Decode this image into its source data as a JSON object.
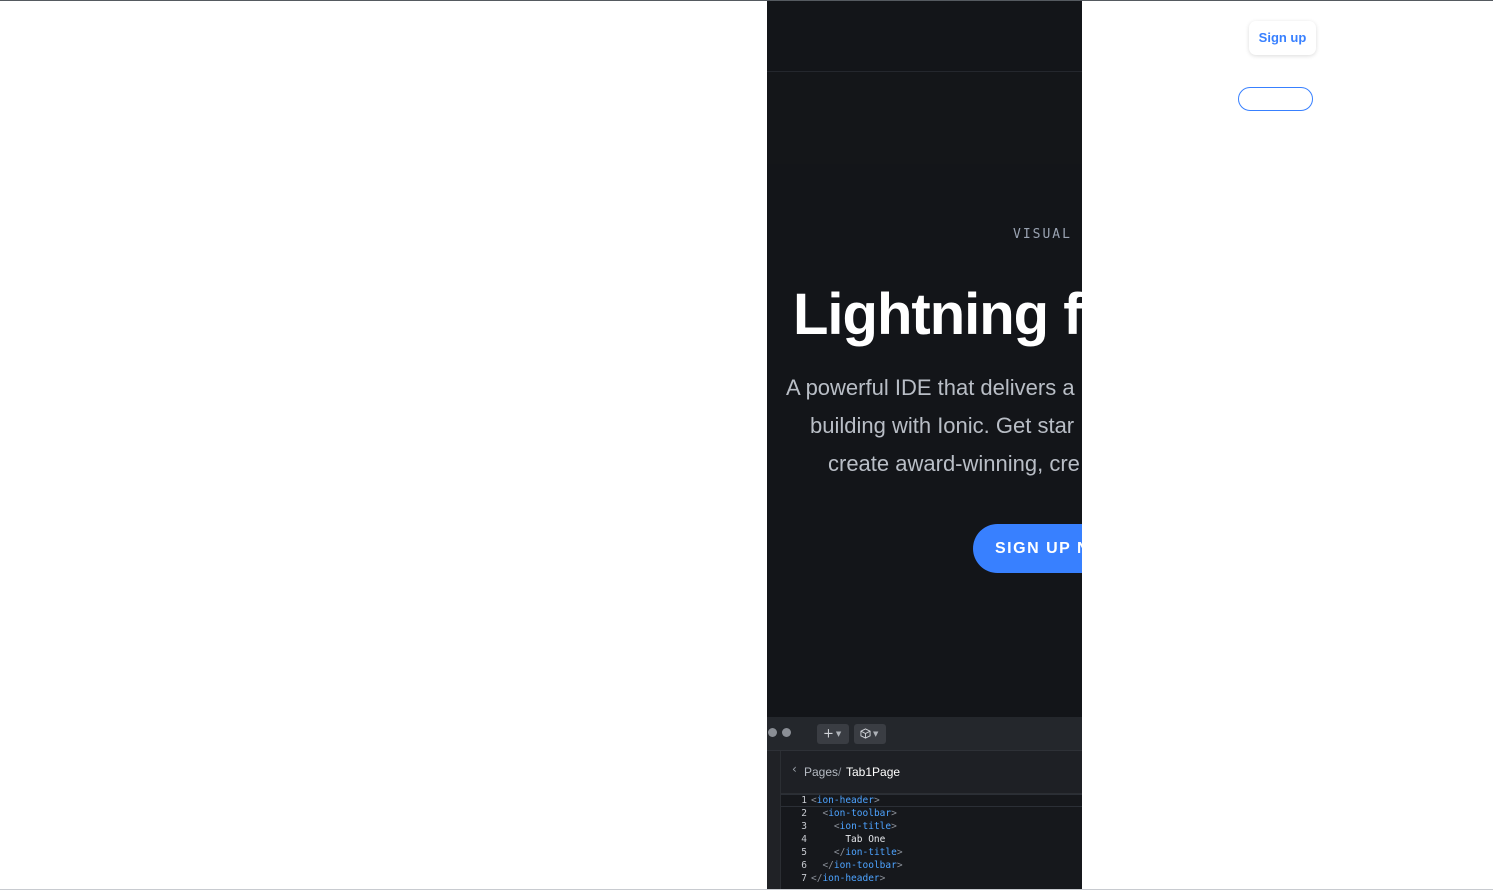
{
  "hero": {
    "eyebrow": "VISUAL M",
    "headline": "Lightning fa",
    "subtitle_lines": [
      "A powerful IDE that delivers a",
      "building with Ionic. Get star",
      "create award-winning, cre"
    ],
    "cta_label": "SIGN UP N"
  },
  "header": {
    "signup_label": "Sign up",
    "outline_button_label": ""
  },
  "ide": {
    "toolbar": {
      "add_icon": "plus-icon",
      "component_icon": "cube-icon"
    },
    "breadcrumb": {
      "back_icon": "chevron-left-icon",
      "parent": "Pages",
      "separator": "/",
      "current": "Tab1Page"
    },
    "code_lines": [
      {
        "num": "1",
        "indent": "",
        "open": "<",
        "tag": "ion-header",
        "close": ">",
        "text": ""
      },
      {
        "num": "2",
        "indent": "  ",
        "open": "<",
        "tag": "ion-toolbar",
        "close": ">",
        "text": ""
      },
      {
        "num": "3",
        "indent": "    ",
        "open": "<",
        "tag": "ion-title",
        "close": ">",
        "text": ""
      },
      {
        "num": "4",
        "indent": "      ",
        "open": "",
        "tag": "",
        "close": "",
        "text": "Tab One"
      },
      {
        "num": "5",
        "indent": "    ",
        "open": "</",
        "tag": "ion-title",
        "close": ">",
        "text": ""
      },
      {
        "num": "6",
        "indent": "  ",
        "open": "</",
        "tag": "ion-toolbar",
        "close": ">",
        "text": ""
      },
      {
        "num": "7",
        "indent": "",
        "open": "</",
        "tag": "ion-header",
        "close": ">",
        "text": ""
      }
    ]
  },
  "colors": {
    "accent": "#3880ff",
    "dark_bg": "#131519",
    "page_bg": "#ffffff"
  }
}
